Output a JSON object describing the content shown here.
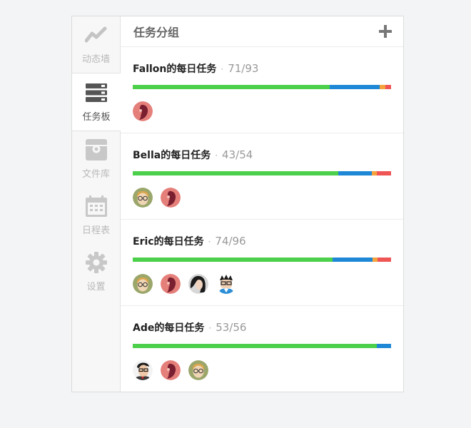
{
  "sidebar": {
    "items": [
      {
        "label": "动态墙",
        "icon": "trend-line-icon",
        "active": false
      },
      {
        "label": "任务板",
        "icon": "task-board-icon",
        "active": true
      },
      {
        "label": "文件库",
        "icon": "file-library-icon",
        "active": false
      },
      {
        "label": "日程表",
        "icon": "calendar-icon",
        "active": false
      },
      {
        "label": "设置",
        "icon": "gear-icon",
        "active": false
      }
    ]
  },
  "header": {
    "title": "任务分组",
    "add_icon": "+"
  },
  "groups": [
    {
      "name": "Fallon的每日任务",
      "sep": "·",
      "count": "71/93",
      "progress": [
        {
          "color": "#4cd04c",
          "fraction": 0.763
        },
        {
          "color": "#1e88d6",
          "fraction": 0.194
        },
        {
          "color": "#f5a23c",
          "fraction": 0.02
        },
        {
          "color": "#f05555",
          "fraction": 0.023
        }
      ],
      "avatars": [
        "avatar-red"
      ]
    },
    {
      "name": "Bella的每日任务",
      "sep": "·",
      "count": "43/54",
      "progress": [
        {
          "color": "#4cd04c",
          "fraction": 0.796
        },
        {
          "color": "#1e88d6",
          "fraction": 0.13
        },
        {
          "color": "#f5a23c",
          "fraction": 0.02
        },
        {
          "color": "#f05555",
          "fraction": 0.054
        }
      ],
      "avatars": [
        "avatar-glasses",
        "avatar-red"
      ]
    },
    {
      "name": "Eric的每日任务",
      "sep": "·",
      "count": "74/96",
      "progress": [
        {
          "color": "#4cd04c",
          "fraction": 0.774
        },
        {
          "color": "#1e88d6",
          "fraction": 0.154
        },
        {
          "color": "#f5a23c",
          "fraction": 0.02
        },
        {
          "color": "#f05555",
          "fraction": 0.052
        }
      ],
      "avatars": [
        "avatar-glasses",
        "avatar-red",
        "avatar-dark-hair",
        "avatar-cartoon"
      ]
    },
    {
      "name": "Ade的每日任务",
      "sep": "·",
      "count": "53/56",
      "progress": [
        {
          "color": "#4cd04c",
          "fraction": 0.946
        },
        {
          "color": "#1e88d6",
          "fraction": 0.054
        }
      ],
      "avatars": [
        "avatar-man-glasses",
        "avatar-red",
        "avatar-glasses"
      ]
    }
  ]
}
